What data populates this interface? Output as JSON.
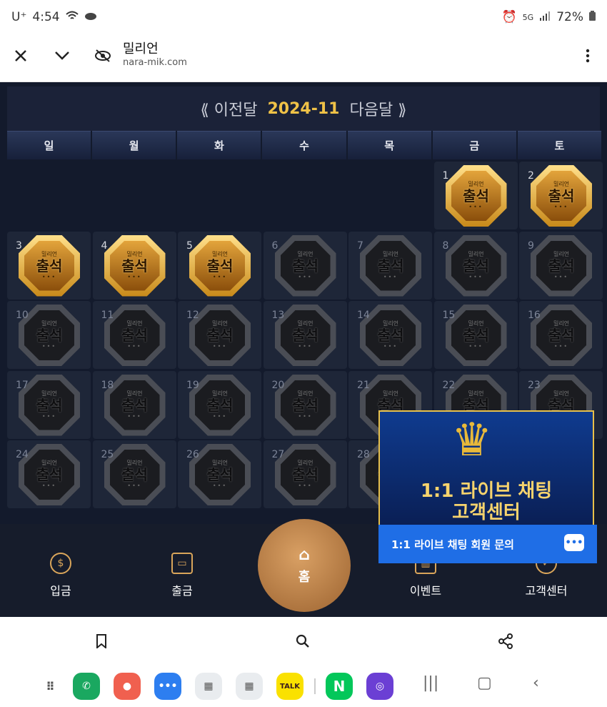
{
  "status": {
    "carrier": "U⁺",
    "time": "4:54",
    "network": "5G",
    "battery": "72%"
  },
  "toolbar": {
    "title": "밀리언",
    "url": "nara-mik.com"
  },
  "calendar": {
    "prev": "⟪ 이전달",
    "month": "2024-11",
    "next": "다음달 ⟫",
    "weekdays": [
      "일",
      "월",
      "화",
      "수",
      "목",
      "금",
      "토"
    ],
    "badge_text": "출석",
    "badge_logo": "밀리언",
    "days": [
      "1",
      "2",
      "3",
      "4",
      "5",
      "6",
      "7",
      "8",
      "9",
      "10",
      "11",
      "12",
      "13",
      "14",
      "15",
      "16",
      "17",
      "18",
      "19",
      "20",
      "21",
      "22",
      "23",
      "24",
      "25",
      "26",
      "27",
      "28"
    ]
  },
  "nav": {
    "deposit": "입금",
    "withdraw": "출금",
    "home": "홈",
    "event": "이벤트",
    "support": "고객센터"
  },
  "chat": {
    "banner_line1": "1:1 라이브 채팅",
    "banner_line2": "고객센터",
    "bar_text": "1:1 라이브 채팅 회원 문의"
  },
  "dock": {
    "talk": "TALK",
    "naver": "N"
  }
}
